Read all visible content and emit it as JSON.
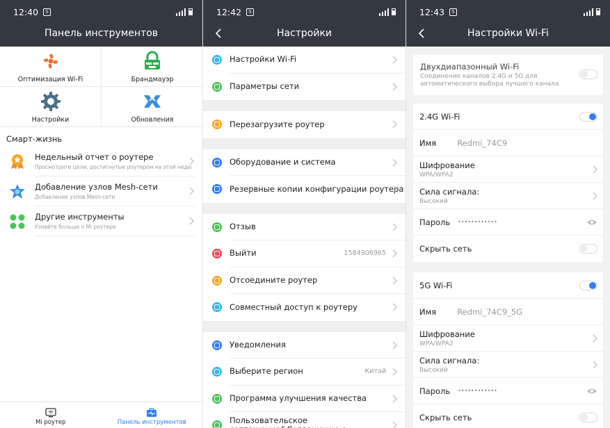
{
  "screen1": {
    "time": "12:40",
    "title": "Панель инструментов",
    "tiles": [
      {
        "label": "Оптимизация Wi-Fi",
        "icon": "fan-icon"
      },
      {
        "label": "Брандмауэр",
        "icon": "firewall-icon"
      },
      {
        "label": "Настройки",
        "icon": "gear-icon"
      },
      {
        "label": "Обновления",
        "icon": "update-icon"
      }
    ],
    "section_title": "Смарт-жизнь",
    "items": [
      {
        "title": "Недельный отчет о роутере",
        "subtitle": "Просмотрите цели, достигнутые роутером на этой неделе",
        "icon": "medal-icon"
      },
      {
        "title": "Добавление узлов Mesh-сети",
        "subtitle": "Добавление узлов Mesh-сети",
        "icon": "mesh-icon"
      },
      {
        "title": "Другие инструменты",
        "subtitle": "Узнайте больше о Mi роутере",
        "icon": "apps-icon"
      }
    ],
    "nav": [
      {
        "label": "Mi роутер",
        "icon": "router-icon"
      },
      {
        "label": "Панель инструментов",
        "icon": "toolbox-icon"
      }
    ],
    "active_color": "#2f7cf6"
  },
  "screen2": {
    "time": "12:42",
    "title": "Настройки",
    "groups": [
      [
        {
          "label": "Настройки Wi-Fi",
          "color": "#37b4ec"
        },
        {
          "label": "Параметры сети",
          "color": "#4cc35a"
        }
      ],
      [
        {
          "label": "Перезагрузите роутер",
          "color": "#f5a623"
        }
      ],
      [
        {
          "label": "Оборудование и система",
          "color": "#2f7cf6"
        },
        {
          "label": "Резервные копии конфигурации роутера",
          "color": "#2f7cf6"
        }
      ],
      [
        {
          "label": "Отзыв",
          "color": "#4cc35a"
        },
        {
          "label": "Выйти",
          "color": "#ef4b5f",
          "value": "1584906965"
        },
        {
          "label": "Отсоедините роутер",
          "color": "#f5a623"
        },
        {
          "label": "Совместный доступ к роутеру",
          "color": "#37b4ec"
        }
      ],
      [
        {
          "label": "Уведомления",
          "color": "#2f7cf6"
        },
        {
          "label": "Выберите регион",
          "color": "#37b4ec",
          "value": "Китай"
        },
        {
          "label": "Программа улучшения качества",
          "color": "#4cc35a"
        },
        {
          "label": "Пользовательское соглашение&Соглашение о",
          "color": "#4cc35a"
        }
      ]
    ]
  },
  "screen3": {
    "time": "12:43",
    "title": "Настройки Wi-Fi",
    "dual": {
      "title": "Двухдиапазонный Wi-Fi",
      "subtitle": "Соединение каналов 2.4G и 5G для автоматического выбора лучшего канала",
      "enabled": false
    },
    "bands": [
      {
        "title": "2.4G Wi-Fi",
        "enabled": true,
        "name_label": "Имя",
        "name_value": "Redmi_74C9",
        "enc_label": "Шифрование",
        "enc_value": "WPA/WPA2",
        "signal_label": "Сила сигнала:",
        "signal_value": "Высокий",
        "pass_label": "Пароль",
        "pass_value": "••••••••••••",
        "hide_label": "Скрыть сеть",
        "hidden": false
      },
      {
        "title": "5G Wi-Fi",
        "enabled": true,
        "name_label": "Имя",
        "name_value": "Redmi_74C9_5G",
        "enc_label": "Шифрование",
        "enc_value": "WPA/WPA2",
        "signal_label": "Сила сигнала:",
        "signal_value": "Высокий",
        "pass_label": "Пароль",
        "pass_value": "••••••••••••",
        "hide_label": "Скрыть сеть",
        "hidden": false
      }
    ]
  }
}
